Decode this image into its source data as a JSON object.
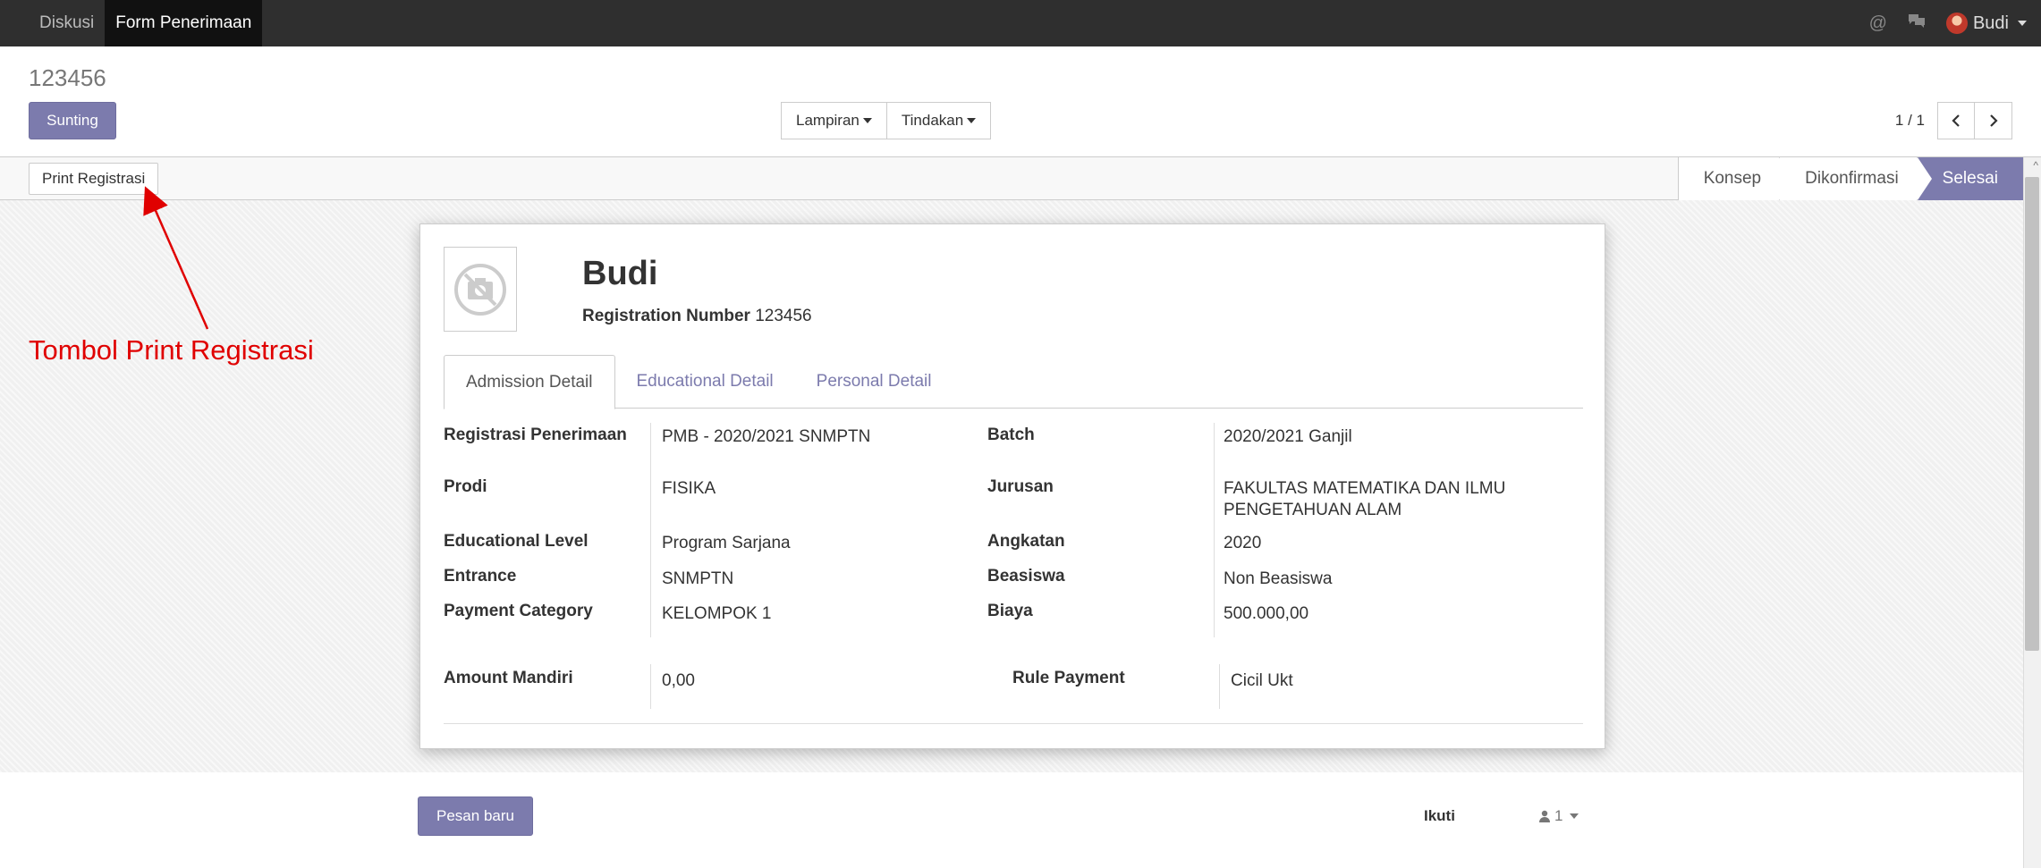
{
  "topbar": {
    "menu": [
      {
        "label": "Diskusi",
        "active": false
      },
      {
        "label": "Form Penerimaan",
        "active": true
      }
    ],
    "user_name": "Budi",
    "icons": [
      "at-icon",
      "chat-icon",
      "user-avatar"
    ]
  },
  "control_panel": {
    "breadcrumb": "123456",
    "edit_label": "Sunting",
    "attachment_label": "Lampiran",
    "action_label": "Tindakan",
    "pager_value": "1 / 1"
  },
  "statusbar": {
    "print_label": "Print Registrasi",
    "stages": [
      {
        "label": "Konsep",
        "state": "inactive"
      },
      {
        "label": "Dikonfirmasi",
        "state": "inactive"
      },
      {
        "label": "Selesai",
        "state": "current"
      }
    ]
  },
  "sheet": {
    "name": "Budi",
    "reg_label": "Registration Number",
    "reg_value": "123456",
    "tabs": [
      {
        "label": "Admission Detail",
        "active": true
      },
      {
        "label": "Educational Detail",
        "active": false
      },
      {
        "label": "Personal Detail",
        "active": false
      }
    ],
    "left_fields": [
      {
        "label": "Registrasi Penerimaan",
        "value": "PMB - 2020/2021 SNMPTN"
      },
      {
        "label": "Prodi",
        "value": "FISIKA"
      },
      {
        "label": "Educational Level",
        "value": "Program Sarjana"
      },
      {
        "label": "Entrance",
        "value": "SNMPTN"
      },
      {
        "label": "Payment Category",
        "value": "KELOMPOK 1"
      }
    ],
    "right_fields": [
      {
        "label": "Batch",
        "value": "2020/2021 Ganjil"
      },
      {
        "label": "Jurusan",
        "value": "FAKULTAS MATEMATIKA DAN ILMU PENGETAHUAN ALAM"
      },
      {
        "label": "Angkatan",
        "value": "2020"
      },
      {
        "label": "Beasiswa",
        "value": "Non Beasiswa"
      },
      {
        "label": "Biaya",
        "value": "500.000,00"
      }
    ],
    "extra_left": {
      "label": "Amount Mandiri",
      "value": "0,00"
    },
    "extra_right": {
      "label": "Rule Payment",
      "value": "Cicil Ukt"
    }
  },
  "chatter": {
    "new_message_label": "Pesan baru",
    "follow_label": "Ikuti",
    "followers_count": "1"
  },
  "annotation": {
    "text": "Tombol Print Registrasi",
    "color": "#e00000"
  },
  "colors": {
    "primary": "#7c7bad",
    "topbar": "#2f2f2f"
  }
}
